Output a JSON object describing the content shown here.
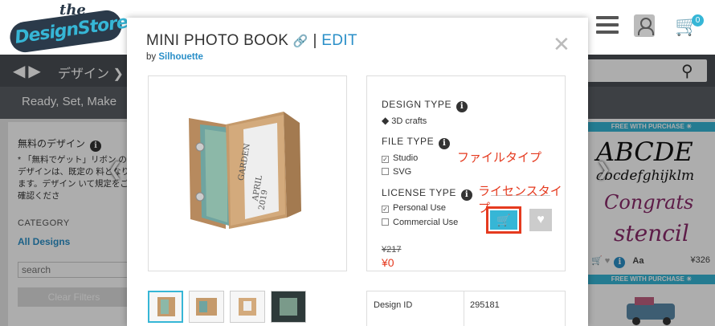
{
  "header": {
    "logo_top": "the",
    "logo_main": "DesignStore",
    "cart_count": "0"
  },
  "nav": {
    "design_label": "デザイン ❯"
  },
  "subbar": {
    "title": "Ready, Set, Make"
  },
  "sidebar": {
    "free_designs": "無料のデザイン",
    "note": "* 「無料でゲット」リボン のデザインは、既定の 料となります。デザイン いて規定をご確認くださ",
    "category_label": "CATEGORY",
    "all_designs": "All Designs",
    "search_placeholder": "search",
    "clear_filters": "Clear Filters"
  },
  "right_column": {
    "banner": "FREE WITH PURCHASE ☀",
    "banner2": "FREE WITH PURCHASE ☀",
    "art_line1": "ABCDE",
    "art_line2": "abcdefghijklm",
    "art_line3": "Congrats",
    "art_line4": "stencil",
    "font_icon": "Aa",
    "price": "¥326"
  },
  "modal": {
    "title": "MINI PHOTO BOOK",
    "separator": "|",
    "edit": "EDIT",
    "by_prefix": "by",
    "author": "Silhouette",
    "close": "✕",
    "design_type_label": "DESIGN TYPE",
    "design_type_value": "3D crafts",
    "file_type_label": "FILE TYPE",
    "file_types": [
      "Studio",
      "SVG"
    ],
    "license_type_label": "LICENSE TYPE",
    "licenses": [
      "Personal Use",
      "Commercial Use"
    ],
    "price_old": "¥217",
    "price_new": "¥0",
    "annotation_file": "ファイルタイプ",
    "annotation_license": "ライセンスタイプ",
    "table": {
      "key": "Design ID",
      "value": "295181"
    },
    "photo_text1": "GARDEN",
    "photo_text2": "APRIL",
    "photo_text3": "2019"
  },
  "colors": {
    "accent": "#36b6d6",
    "link": "#2a8fc8",
    "annotation_red": "#e53a1f"
  }
}
